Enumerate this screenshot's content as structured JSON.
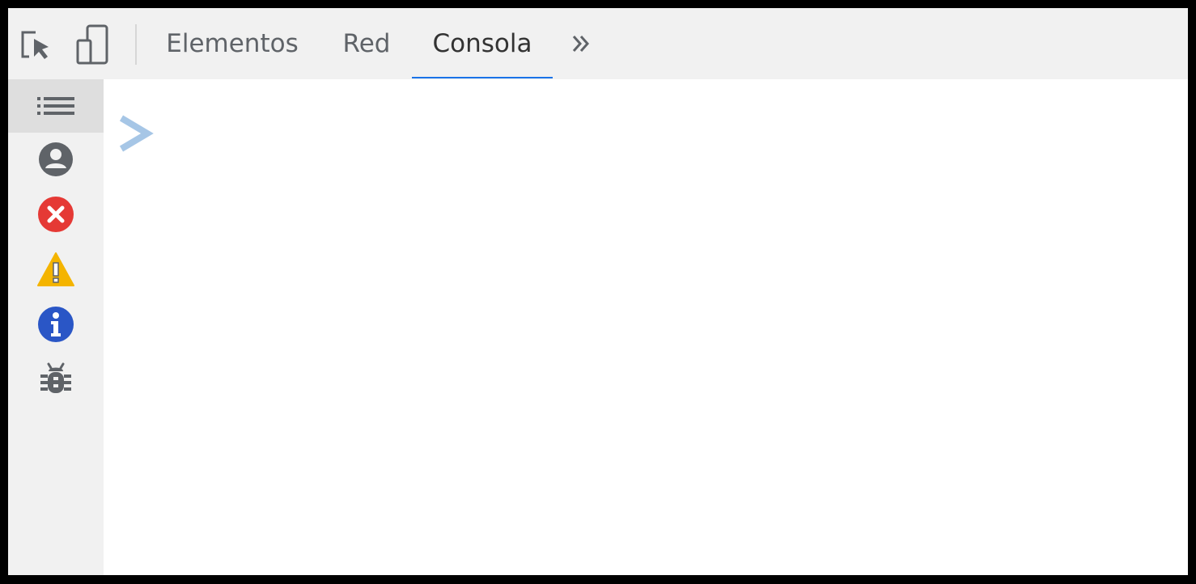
{
  "toolbar": {
    "inspect_icon": "element-picker-icon",
    "device_icon": "device-toggle-icon",
    "more_icon": "chevron-double-right-icon",
    "tabs": [
      {
        "label": "Elementos",
        "active": false
      },
      {
        "label": "Red",
        "active": false
      },
      {
        "label": "Consola",
        "active": true
      }
    ]
  },
  "sidebar": {
    "items": [
      {
        "icon": "list-icon",
        "selected": true
      },
      {
        "icon": "user-icon",
        "selected": false
      },
      {
        "icon": "error-icon",
        "selected": false
      },
      {
        "icon": "warning-icon",
        "selected": false
      },
      {
        "icon": "info-icon",
        "selected": false
      },
      {
        "icon": "bug-icon",
        "selected": false
      }
    ]
  },
  "console": {
    "prompt_icon": "prompt-chevron-icon"
  },
  "colors": {
    "accent": "#1a73e8",
    "error": "#e53935",
    "warning": "#f4b400",
    "info": "#2a56c6",
    "prompt": "#a6c6e6",
    "icon_gray": "#5f6368"
  }
}
